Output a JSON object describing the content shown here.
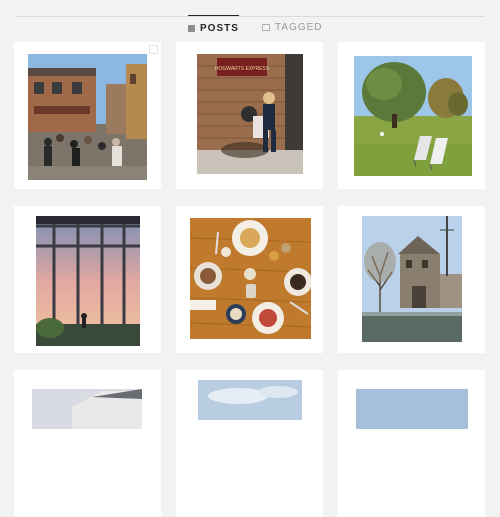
{
  "tabs": [
    {
      "label": "POSTS",
      "active": true,
      "icon": "grid-icon"
    },
    {
      "label": "TAGGED",
      "active": false,
      "icon": "tag-icon"
    }
  ],
  "photos": {
    "p1": {
      "sign": ""
    },
    "p2": {
      "sign": "HOGWARTS EXPRESS"
    }
  },
  "colors": {
    "active_tab": "#262626",
    "inactive_tab": "#999999",
    "background": "#f2f2f2",
    "card": "#ffffff"
  }
}
